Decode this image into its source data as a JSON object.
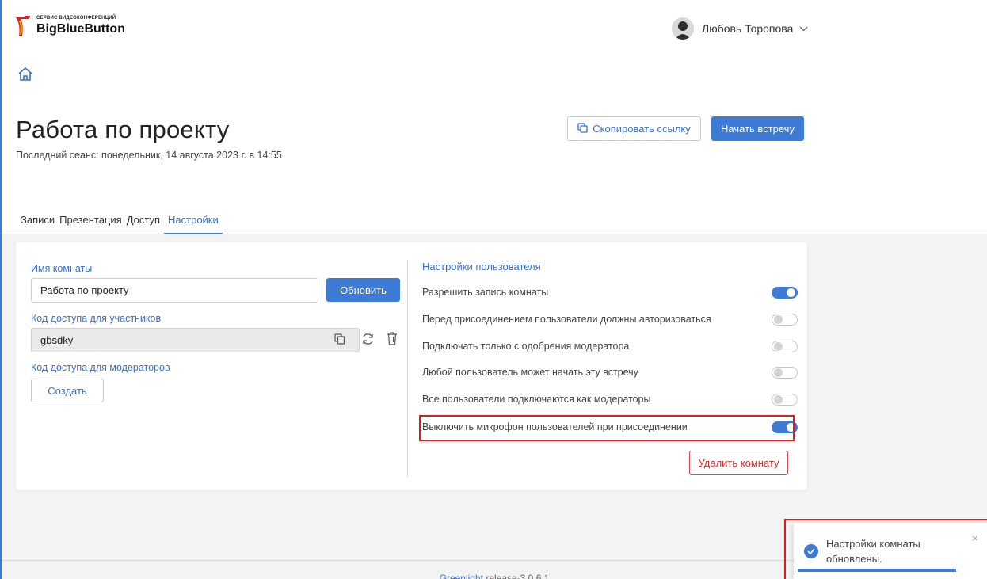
{
  "brand": {
    "tagline": "СЕРВИС ВИДЕОКОНФЕРЕНЦИЙ",
    "name": "BigBlueButton"
  },
  "user": {
    "name": "Любовь Торопова"
  },
  "room": {
    "title": "Работа по проекту",
    "last_session": "Последний сеанс: понедельник, 14 августа 2023 г. в 14:55",
    "copy_link_label": "Скопировать ссылку",
    "start_meeting_label": "Начать встречу"
  },
  "tabs": [
    {
      "label": "Записи"
    },
    {
      "label": "Презентация"
    },
    {
      "label": "Доступ"
    },
    {
      "label": "Настройки",
      "active": true
    }
  ],
  "settings": {
    "room_name_label": "Имя комнаты",
    "room_name_value": "Работа по проекту",
    "update_label": "Обновить",
    "participant_code_label": "Код доступа для участников",
    "participant_code_value": "gbsdky",
    "moderator_code_label": "Код доступа для модераторов",
    "create_label": "Создать",
    "user_settings_title": "Настройки пользователя",
    "options": [
      {
        "label": "Разрешить запись комнаты",
        "on": true
      },
      {
        "label": "Перед присоединением пользователи должны авторизоваться",
        "on": false
      },
      {
        "label": "Подключать только с одобрения модератора",
        "on": false
      },
      {
        "label": "Любой пользователь может начать эту встречу",
        "on": false
      },
      {
        "label": "Все пользователи подключаются как модераторы",
        "on": false
      },
      {
        "label": "Выключить микрофон пользователей при присоединении",
        "on": true
      }
    ],
    "delete_label": "Удалить комнату"
  },
  "toast": {
    "message": "Настройки комнаты обновлены.",
    "close": "×"
  },
  "footer": {
    "link": "Greenlight",
    "release": " release-3.0.6.1"
  },
  "colors": {
    "accent": "#3d7bd4",
    "danger": "#e01b1b",
    "background": "#f3f3f4"
  }
}
